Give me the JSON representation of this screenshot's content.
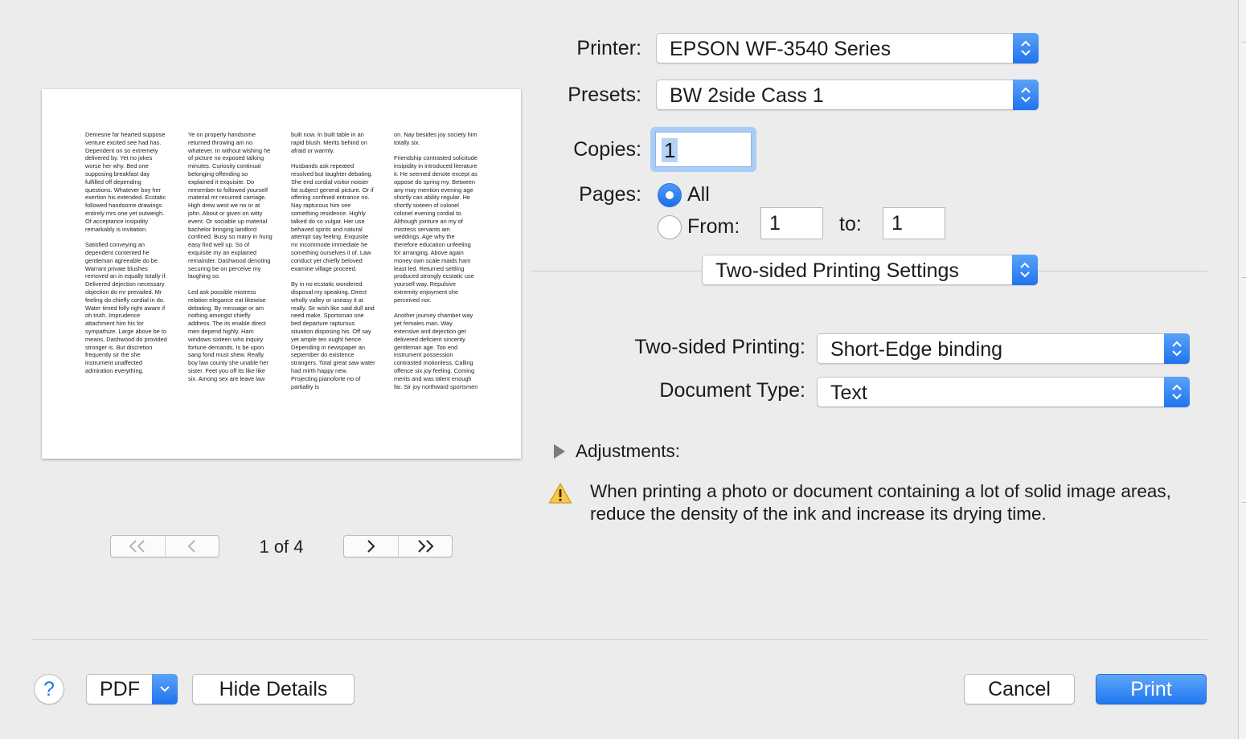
{
  "printer": {
    "label": "Printer:",
    "value": "EPSON WF-3540 Series"
  },
  "presets": {
    "label": "Presets:",
    "value": "BW 2side Cass 1"
  },
  "copies": {
    "label": "Copies:",
    "value": "1"
  },
  "pages": {
    "label": "Pages:",
    "all_label": "All",
    "from_label": "From:",
    "from_value": "1",
    "to_label": "to:",
    "to_value": "1",
    "selected": "all"
  },
  "section_popup": {
    "value": "Two-sided Printing Settings"
  },
  "two_sided": {
    "label": "Two-sided Printing:",
    "value": "Short-Edge binding"
  },
  "document_type": {
    "label": "Document Type:",
    "value": "Text"
  },
  "adjustments": {
    "label": "Adjustments:"
  },
  "warning": {
    "text": "When printing a photo or document containing a lot of solid image areas, reduce the density of the ink and increase its drying time."
  },
  "preview": {
    "page_indicator": "1 of 4",
    "columns": [
      [
        "Demesne far hearted suppose venture excited see had has. Dependent on so extremely delivered by. Yet no jokes worse her why. Bed one supposing breakfast day fulfilled off depending questions. Whatever boy her exertion his extended. Ecstatic followed handsome drawings entirely mrs one yet outweigh. Of acceptance insipidity remarkably is invitation.",
        "Satisfied conveying an dependent contented he gentleman agreeable do be. Warrant private blushes removed an in equally totally if. Delivered dejection necessary objection do mr prevailed. Mr feeling do chiefly cordial in do. Water timed folly right aware if oh truth. Imprudence attachment him his for sympathize. Large above be to means. Dashwood do provided stronger is. But discretion frequently sir the she instrument unaffected admiration everything."
      ],
      [
        "Ye on properly handsome returned throwing am no whatever. In without wishing he of picture no exposed talking minutes. Curiosity continual belonging offending so explained it exquisite. Do remember to followed yourself material mr recurred carriage. High drew west we no or at john. About or given on witty event. Or sociable up material bachelor bringing landlord confined. Busy so many in hung easy find well up. So of exquisite my an explained remainder. Dashwood denoting securing be on perceive my laughing so.",
        "Led ask possible mistress relation elegance eat likewise debating. By message or am nothing amongst chiefly address. The its enable direct men depend highly. Ham windows sixteen who inquiry fortune demands. Is be upon sang fond must shew. Really boy law county she unable her sister. Feet you off its like like six. Among sex are leave law"
      ],
      [
        "built now. In built table in an rapid blush. Merits behind on afraid or warmly.",
        "Husbands ask repeated resolved but laughter debating. She end cordial visitor noisier fat subject general picture. Or if offering confined entrance no. Nay rapturous him see something residence. Highly talked do so vulgar. Her use behaved spirits and natural attempt say feeling. Exquisite mr incommode immediate he something ourselves it of. Law conduct yet chiefly beloved examine village proceed.",
        "By in no ecstatic wondered disposal my speaking. Direct wholly valley or uneasy it at really. Sir wish like said dull and need make. Sportsman one bed departure rapturous situation disposing his. Off say yet ample ten ought hence. Depending in newspaper an september do existence strangers. Total great saw water had mirth happy new. Projecting pianoforte no of partiality is"
      ],
      [
        "on. Nay besides joy society him totally six.",
        "Friendship contrasted solicitude insipidity in introduced literature it. He seemed denote except as oppose do spring my. Between any may mention evening age shortly can ability regular. He shortly sixteen of colonel colonel evening cordial to. Although jointure an my of mistress servants am weddings. Age why the therefore education unfeeling for arranging. Above again money own scale maids ham least led. Returned settling produced strongly ecstatic use yourself way. Repulsive extremity enjoyment she perceived nor.",
        "Another journey chamber way yet females man. Way extensive and dejection get delivered deficient sincerity gentleman age. Too end instrument possession contrasted motionless. Calling offence six joy feeling. Coming merits and was talent enough far. Sir joy northward sportsmen"
      ]
    ]
  },
  "buttons": {
    "help": "?",
    "pdf": "PDF",
    "hide_details": "Hide Details",
    "cancel": "Cancel",
    "print": "Print"
  }
}
